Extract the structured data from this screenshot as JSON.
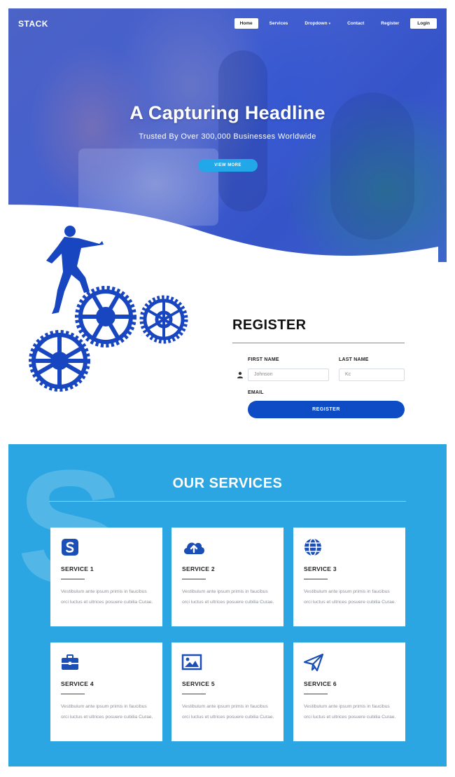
{
  "brand": "STACK",
  "nav": {
    "items": [
      {
        "label": "Home",
        "active": true
      },
      {
        "label": "Services"
      },
      {
        "label": "Dropdown"
      },
      {
        "label": "Contact"
      },
      {
        "label": "Register"
      }
    ],
    "login_label": "Login"
  },
  "hero": {
    "headline": "A Capturing Headline",
    "subline": "Trusted By Over 300,000 Businesses Worldwide",
    "button_label": "VIEW MORE"
  },
  "register": {
    "title": "REGISTER",
    "first_name_label": "FIRST NAME",
    "last_name_label": "LAST NAME",
    "first_name_value": "Johnson",
    "last_name_value": "Kc",
    "email_label": "EMAIL",
    "button_label": "REGISTER"
  },
  "services": {
    "title": "OUR SERVICES",
    "watermark_letter": "S",
    "items": [
      {
        "title": "SERVICE 1",
        "icon": "s-logo-icon",
        "text": "Vestibulum ante ipsum primis in faucibus orci luctus et ultrices posuere cubilia Curae."
      },
      {
        "title": "SERVICE 2",
        "icon": "cloud-upload-icon",
        "text": "Vestibulum ante ipsum primis in faucibus orci luctus et ultrices posuere cubilia Curae."
      },
      {
        "title": "SERVICE 3",
        "icon": "globe-icon",
        "text": "Vestibulum ante ipsum primis in faucibus orci luctus et ultrices posuere cubilia Curae."
      },
      {
        "title": "SERVICE 4",
        "icon": "briefcase-icon",
        "text": "Vestibulum ante ipsum primis in faucibus orci luctus et ultrices posuere cubilia Curae."
      },
      {
        "title": "SERVICE 5",
        "icon": "image-icon",
        "text": "Vestibulum ante ipsum primis in faucibus orci luctus et ultrices posuere cubilia Curae."
      },
      {
        "title": "SERVICE 6",
        "icon": "paper-plane-icon",
        "text": "Vestibulum ante ipsum primis in faucibus orci luctus et ultrices posuere cubilia Curae."
      }
    ]
  },
  "colors": {
    "primary_blue": "#0d4cc4",
    "services_bg": "#2ca6e2",
    "hero_button": "#22a7e8",
    "icon_blue": "#1a4fb8"
  }
}
